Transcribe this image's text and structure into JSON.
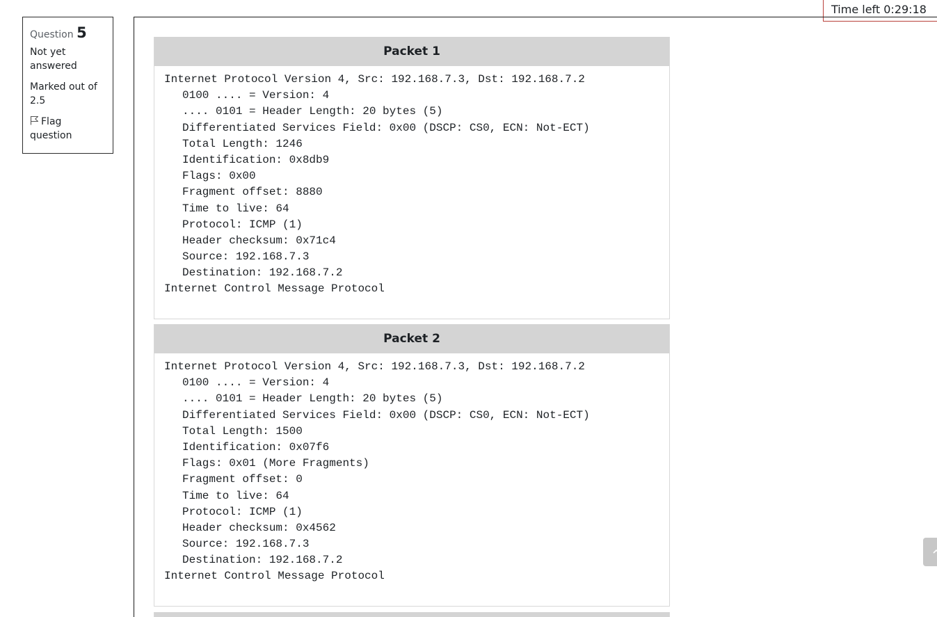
{
  "timer": {
    "text": "Time left 0:29:18"
  },
  "question": {
    "label": "Question",
    "number": "5",
    "state": "Not yet answered",
    "grade": "Marked out of 2.5",
    "flag_label": "Flag question",
    "flag_icon": "flag-icon"
  },
  "packets": [
    {
      "title": "Packet 1",
      "lines": [
        "Internet Protocol Version 4, Src: 192.168.7.3, Dst: 192.168.7.2",
        "0100 .... = Version: 4",
        ".... 0101 = Header Length: 20 bytes (5)",
        "Differentiated Services Field: 0x00 (DSCP: CS0, ECN: Not-ECT)",
        "Total Length: 1246",
        "Identification: 0x8db9",
        "Flags: 0x00",
        "Fragment offset: 8880",
        "Time to live: 64",
        "Protocol: ICMP (1)",
        "Header checksum: 0x71c4",
        "Source: 192.168.7.3",
        "Destination: 192.168.7.2",
        "Internet Control Message Protocol"
      ]
    },
    {
      "title": "Packet 2",
      "lines": [
        "Internet Protocol Version 4, Src: 192.168.7.3, Dst: 192.168.7.2",
        "0100 .... = Version: 4",
        ".... 0101 = Header Length: 20 bytes (5)",
        "Differentiated Services Field: 0x00 (DSCP: CS0, ECN: Not-ECT)",
        "Total Length: 1500",
        "Identification: 0x07f6",
        "Flags: 0x01 (More Fragments)",
        "Fragment offset: 0",
        "Time to live: 64",
        "Protocol: ICMP (1)",
        "Header checksum: 0x4562",
        "Source: 192.168.7.3",
        "Destination: 192.168.7.2",
        "Internet Control Message Protocol"
      ]
    }
  ],
  "colors": {
    "header_bg": "#d4d4d4",
    "timer_border": "#b9403a",
    "text": "#1d2125"
  },
  "scroll_top_icon": "chevron-up-icon"
}
